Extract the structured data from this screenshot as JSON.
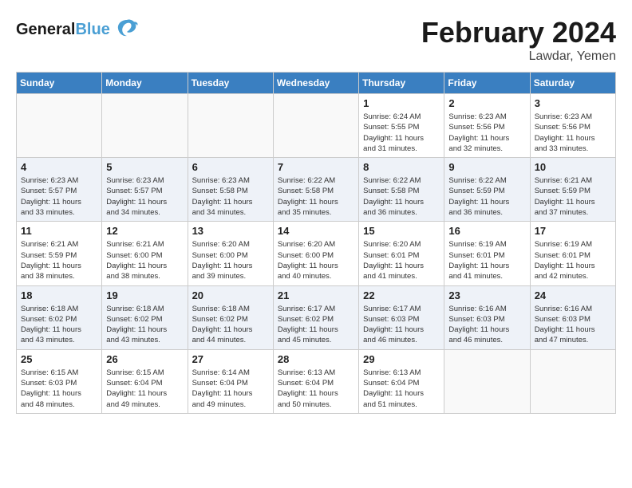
{
  "header": {
    "logo_general": "General",
    "logo_blue": "Blue",
    "month": "February 2024",
    "location": "Lawdar, Yemen"
  },
  "days_of_week": [
    "Sunday",
    "Monday",
    "Tuesday",
    "Wednesday",
    "Thursday",
    "Friday",
    "Saturday"
  ],
  "weeks": [
    [
      {
        "day": "",
        "info": ""
      },
      {
        "day": "",
        "info": ""
      },
      {
        "day": "",
        "info": ""
      },
      {
        "day": "",
        "info": ""
      },
      {
        "day": "1",
        "info": "Sunrise: 6:24 AM\nSunset: 5:55 PM\nDaylight: 11 hours\nand 31 minutes."
      },
      {
        "day": "2",
        "info": "Sunrise: 6:23 AM\nSunset: 5:56 PM\nDaylight: 11 hours\nand 32 minutes."
      },
      {
        "day": "3",
        "info": "Sunrise: 6:23 AM\nSunset: 5:56 PM\nDaylight: 11 hours\nand 33 minutes."
      }
    ],
    [
      {
        "day": "4",
        "info": "Sunrise: 6:23 AM\nSunset: 5:57 PM\nDaylight: 11 hours\nand 33 minutes."
      },
      {
        "day": "5",
        "info": "Sunrise: 6:23 AM\nSunset: 5:57 PM\nDaylight: 11 hours\nand 34 minutes."
      },
      {
        "day": "6",
        "info": "Sunrise: 6:23 AM\nSunset: 5:58 PM\nDaylight: 11 hours\nand 34 minutes."
      },
      {
        "day": "7",
        "info": "Sunrise: 6:22 AM\nSunset: 5:58 PM\nDaylight: 11 hours\nand 35 minutes."
      },
      {
        "day": "8",
        "info": "Sunrise: 6:22 AM\nSunset: 5:58 PM\nDaylight: 11 hours\nand 36 minutes."
      },
      {
        "day": "9",
        "info": "Sunrise: 6:22 AM\nSunset: 5:59 PM\nDaylight: 11 hours\nand 36 minutes."
      },
      {
        "day": "10",
        "info": "Sunrise: 6:21 AM\nSunset: 5:59 PM\nDaylight: 11 hours\nand 37 minutes."
      }
    ],
    [
      {
        "day": "11",
        "info": "Sunrise: 6:21 AM\nSunset: 5:59 PM\nDaylight: 11 hours\nand 38 minutes."
      },
      {
        "day": "12",
        "info": "Sunrise: 6:21 AM\nSunset: 6:00 PM\nDaylight: 11 hours\nand 38 minutes."
      },
      {
        "day": "13",
        "info": "Sunrise: 6:20 AM\nSunset: 6:00 PM\nDaylight: 11 hours\nand 39 minutes."
      },
      {
        "day": "14",
        "info": "Sunrise: 6:20 AM\nSunset: 6:00 PM\nDaylight: 11 hours\nand 40 minutes."
      },
      {
        "day": "15",
        "info": "Sunrise: 6:20 AM\nSunset: 6:01 PM\nDaylight: 11 hours\nand 41 minutes."
      },
      {
        "day": "16",
        "info": "Sunrise: 6:19 AM\nSunset: 6:01 PM\nDaylight: 11 hours\nand 41 minutes."
      },
      {
        "day": "17",
        "info": "Sunrise: 6:19 AM\nSunset: 6:01 PM\nDaylight: 11 hours\nand 42 minutes."
      }
    ],
    [
      {
        "day": "18",
        "info": "Sunrise: 6:18 AM\nSunset: 6:02 PM\nDaylight: 11 hours\nand 43 minutes."
      },
      {
        "day": "19",
        "info": "Sunrise: 6:18 AM\nSunset: 6:02 PM\nDaylight: 11 hours\nand 43 minutes."
      },
      {
        "day": "20",
        "info": "Sunrise: 6:18 AM\nSunset: 6:02 PM\nDaylight: 11 hours\nand 44 minutes."
      },
      {
        "day": "21",
        "info": "Sunrise: 6:17 AM\nSunset: 6:02 PM\nDaylight: 11 hours\nand 45 minutes."
      },
      {
        "day": "22",
        "info": "Sunrise: 6:17 AM\nSunset: 6:03 PM\nDaylight: 11 hours\nand 46 minutes."
      },
      {
        "day": "23",
        "info": "Sunrise: 6:16 AM\nSunset: 6:03 PM\nDaylight: 11 hours\nand 46 minutes."
      },
      {
        "day": "24",
        "info": "Sunrise: 6:16 AM\nSunset: 6:03 PM\nDaylight: 11 hours\nand 47 minutes."
      }
    ],
    [
      {
        "day": "25",
        "info": "Sunrise: 6:15 AM\nSunset: 6:03 PM\nDaylight: 11 hours\nand 48 minutes."
      },
      {
        "day": "26",
        "info": "Sunrise: 6:15 AM\nSunset: 6:04 PM\nDaylight: 11 hours\nand 49 minutes."
      },
      {
        "day": "27",
        "info": "Sunrise: 6:14 AM\nSunset: 6:04 PM\nDaylight: 11 hours\nand 49 minutes."
      },
      {
        "day": "28",
        "info": "Sunrise: 6:13 AM\nSunset: 6:04 PM\nDaylight: 11 hours\nand 50 minutes."
      },
      {
        "day": "29",
        "info": "Sunrise: 6:13 AM\nSunset: 6:04 PM\nDaylight: 11 hours\nand 51 minutes."
      },
      {
        "day": "",
        "info": ""
      },
      {
        "day": "",
        "info": ""
      }
    ]
  ]
}
